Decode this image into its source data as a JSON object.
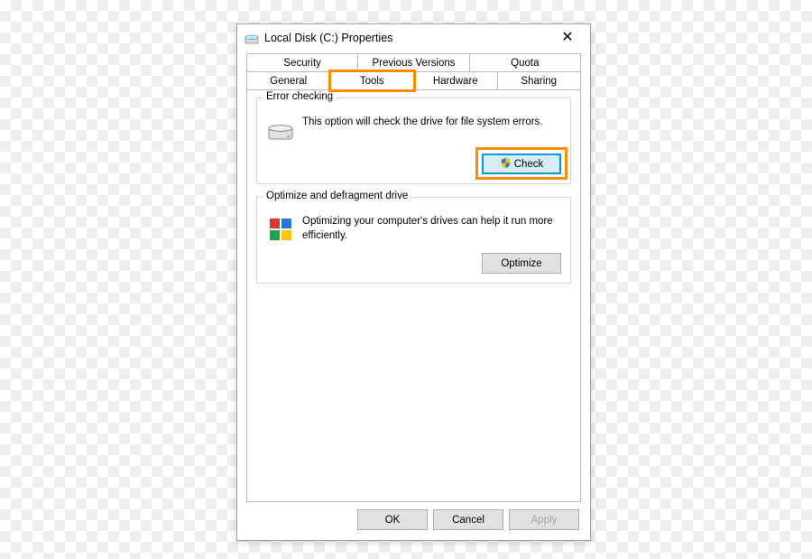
{
  "window": {
    "title": "Local Disk (C:) Properties"
  },
  "tabs": {
    "row1": [
      "Security",
      "Previous Versions",
      "Quota"
    ],
    "row2": [
      "General",
      "Tools",
      "Hardware",
      "Sharing"
    ],
    "active": "Tools"
  },
  "groups": {
    "errorCheck": {
      "title": "Error checking",
      "desc": "This option will check the drive for file system errors.",
      "button": "Check"
    },
    "optimize": {
      "title": "Optimize and defragment drive",
      "desc": "Optimizing your computer's drives can help it run more efficiently.",
      "button": "Optimize"
    }
  },
  "footer": {
    "ok": "OK",
    "cancel": "Cancel",
    "apply": "Apply"
  },
  "highlight_color": "#ff8c00"
}
